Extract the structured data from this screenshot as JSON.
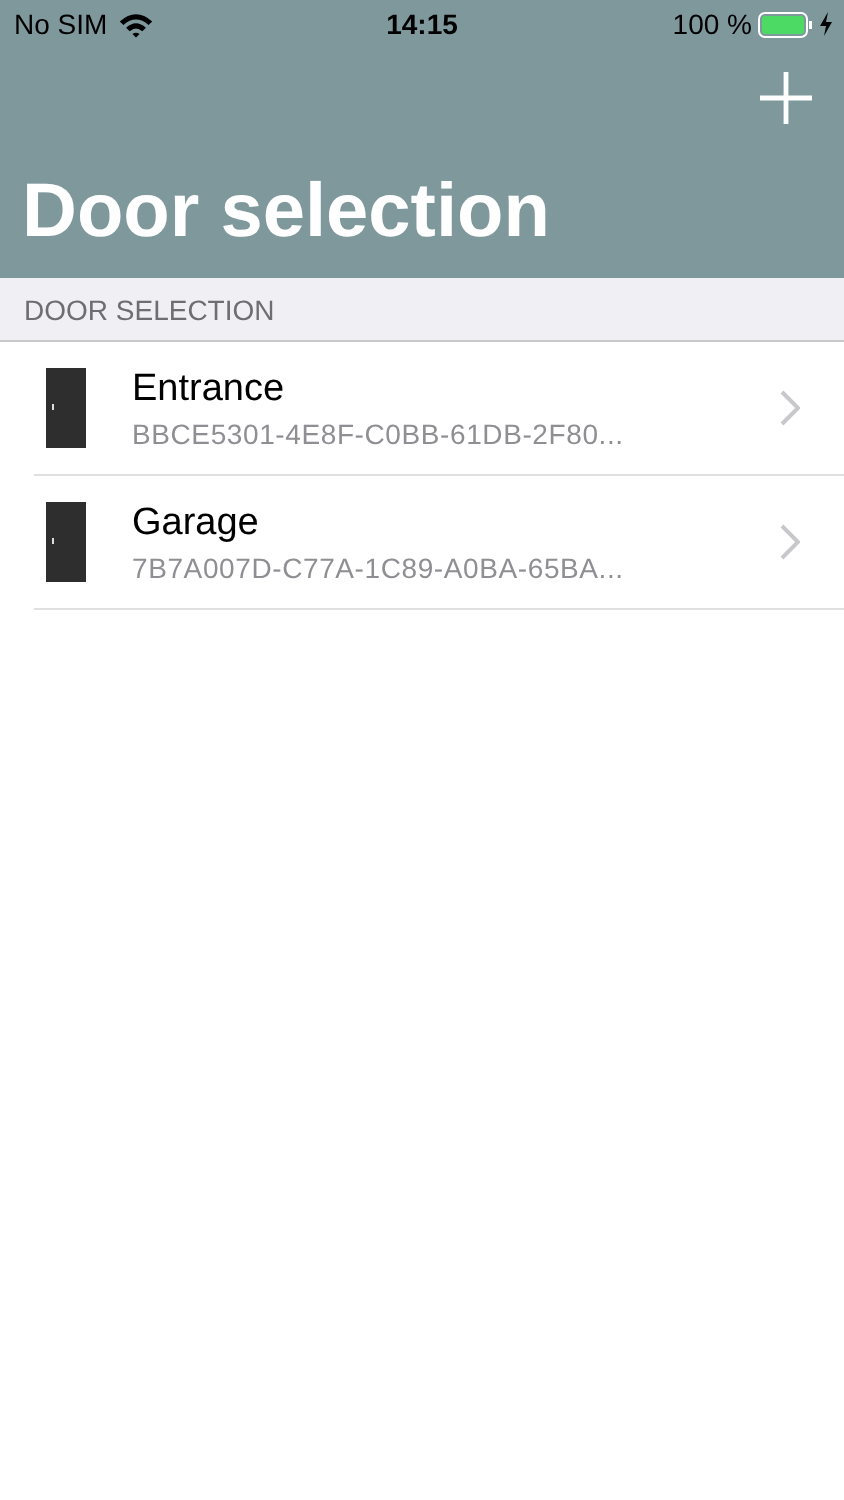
{
  "status_bar": {
    "carrier": "No SIM",
    "time": "14:15",
    "battery": "100 %",
    "charging": true
  },
  "nav": {
    "title": "Door selection"
  },
  "section": {
    "header": "DOOR SELECTION"
  },
  "doors": [
    {
      "name": "Entrance",
      "id": "BBCE5301-4E8F-C0BB-61DB-2F80..."
    },
    {
      "name": "Garage",
      "id": "7B7A007D-C77A-1C89-A0BA-65BA..."
    }
  ]
}
